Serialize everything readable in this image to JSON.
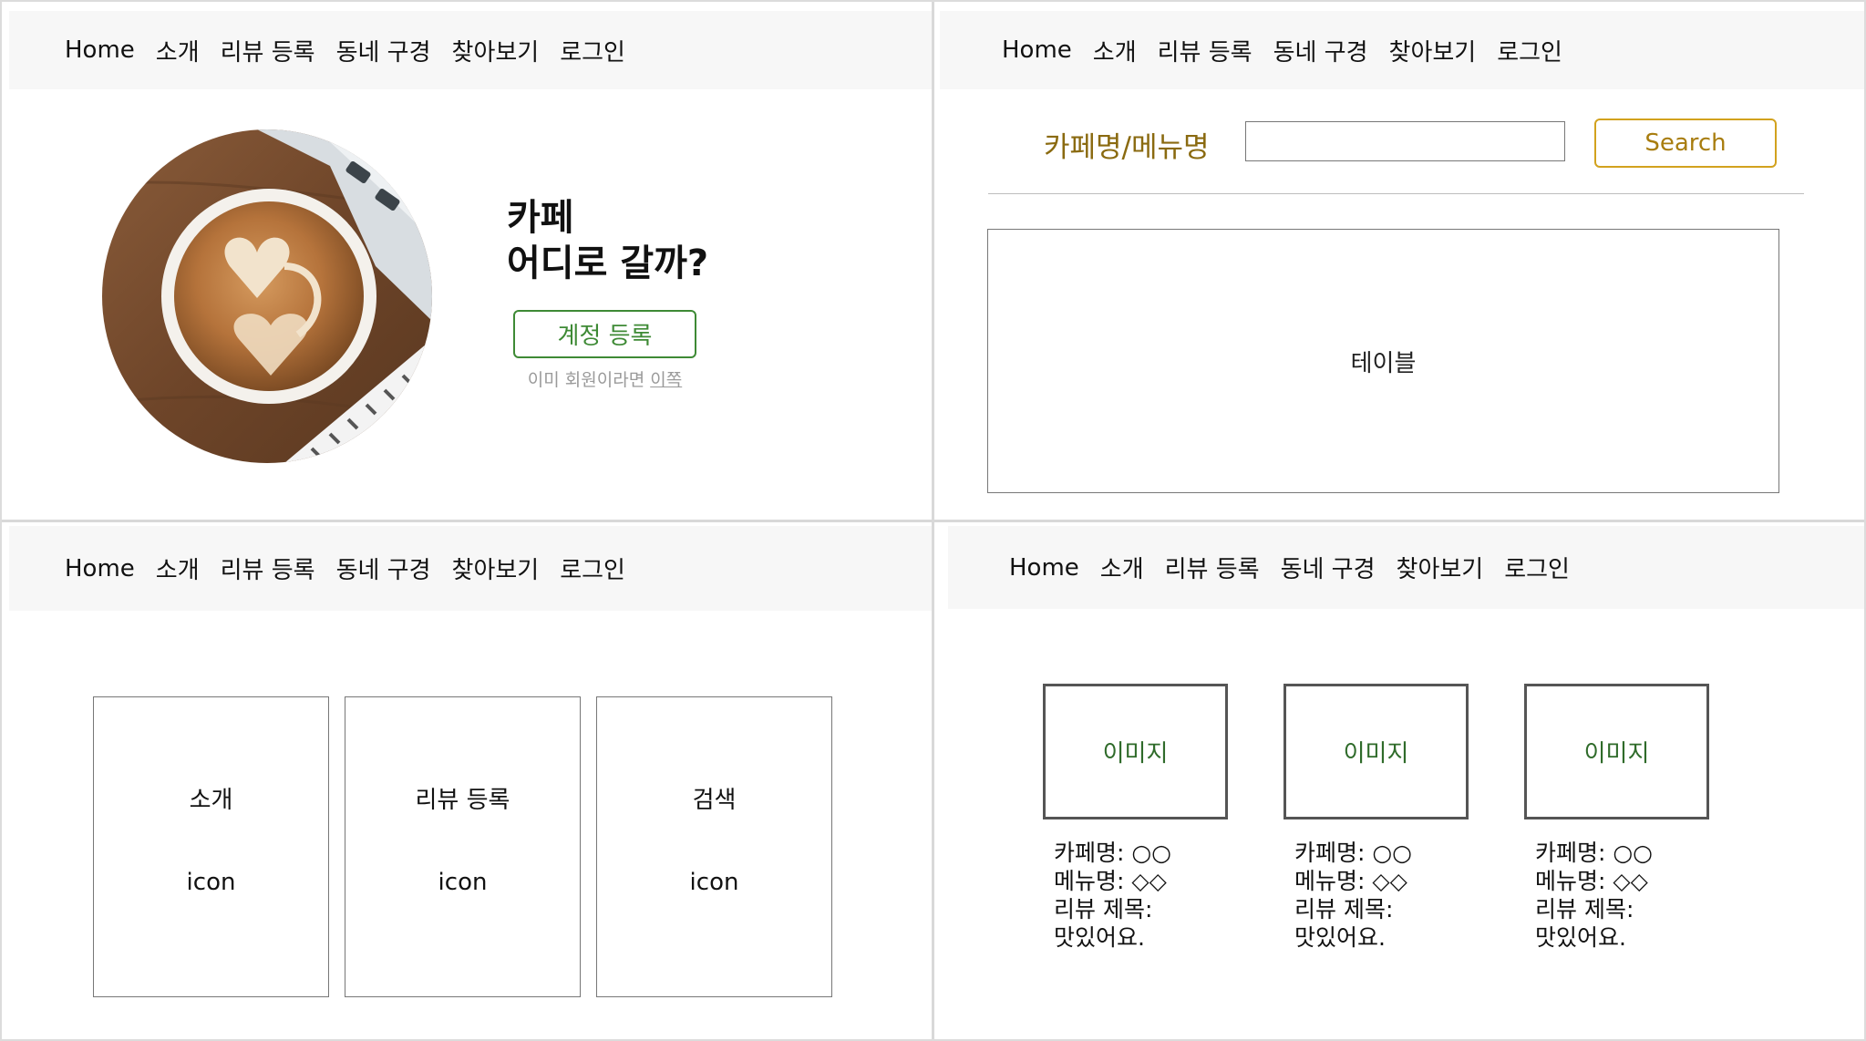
{
  "nav": {
    "items": [
      "Home",
      "소개",
      "리뷰 등록",
      "동네 구경",
      "찾아보기",
      "로그인"
    ]
  },
  "landing": {
    "title_line1": "카페",
    "title_line2": "어디로 갈까?",
    "register_button": "계정 등록",
    "member_text": "이미 회원이라면",
    "member_link": "이쪽"
  },
  "search": {
    "label": "카페명/메뉴명",
    "input_value": "",
    "button": "Search",
    "table_placeholder": "테이블"
  },
  "features": {
    "cards": [
      {
        "title": "소개",
        "icon": "icon"
      },
      {
        "title": "리뷰 등록",
        "icon": "icon"
      },
      {
        "title": "검색",
        "icon": "icon"
      }
    ]
  },
  "reviews": {
    "items": [
      {
        "image": "이미지",
        "cafe": "카페명: ○○",
        "menu": "메뉴명: ◇◇",
        "title": "리뷰 제목:",
        "body": "맛있어요."
      },
      {
        "image": "이미지",
        "cafe": "카페명: ○○",
        "menu": "메뉴명: ◇◇",
        "title": "리뷰 제목:",
        "body": "맛있어요."
      },
      {
        "image": "이미지",
        "cafe": "카페명: ○○",
        "menu": "메뉴명: ◇◇",
        "title": "리뷰 제목:",
        "body": "맛있어요."
      }
    ]
  },
  "colors": {
    "register_green": "#3e8a35",
    "search_gold": "#d2a21e",
    "label_brown": "#8a6a10",
    "nav_bg": "#f7f7f7"
  }
}
